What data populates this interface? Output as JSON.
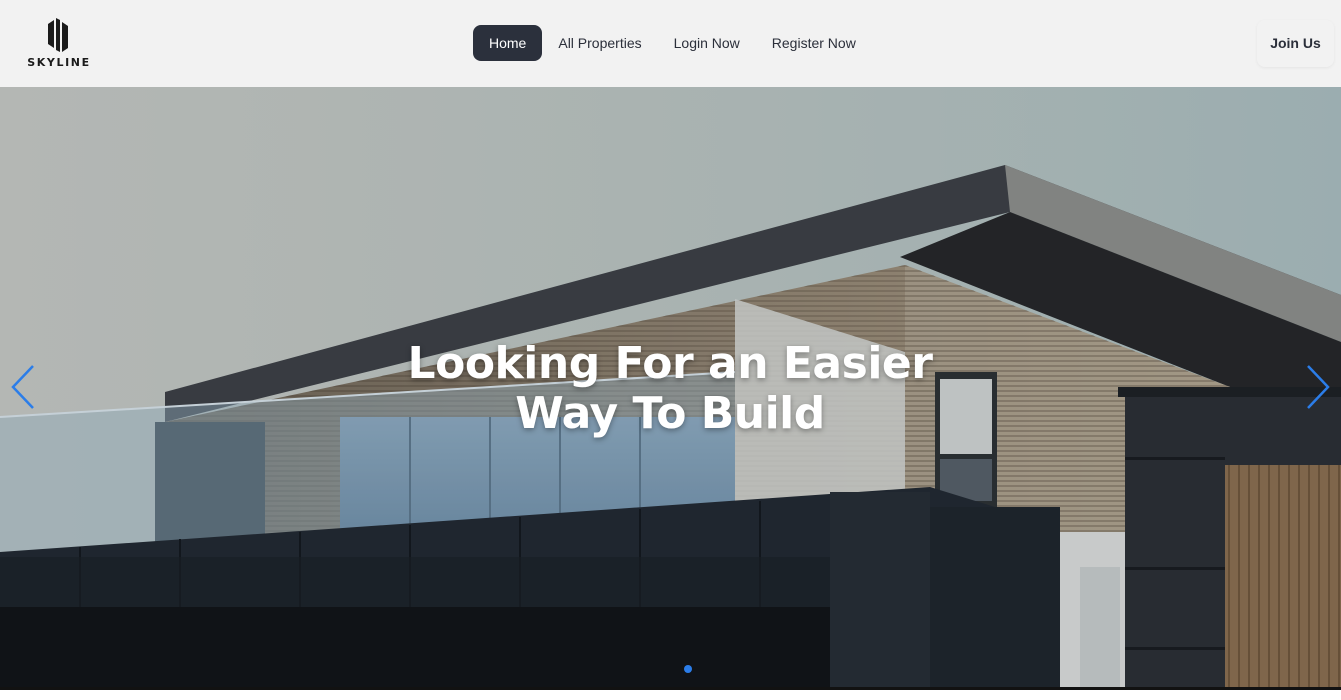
{
  "brand": {
    "name": "SKYLINE"
  },
  "nav": {
    "items": [
      {
        "label": "Home",
        "active": true
      },
      {
        "label": "All Properties",
        "active": false
      },
      {
        "label": "Login Now",
        "active": false
      },
      {
        "label": "Register Now",
        "active": false
      }
    ],
    "join_label": "Join Us"
  },
  "hero": {
    "title": "Looking For an Easier Way To Build",
    "prev_icon": "chevron-left-icon",
    "next_icon": "chevron-right-icon",
    "slide_count": 1,
    "active_slide": 1
  },
  "colors": {
    "nav_bg": "#f2f2f2",
    "active_bg": "#2b303c",
    "accent": "#2b7de9"
  }
}
